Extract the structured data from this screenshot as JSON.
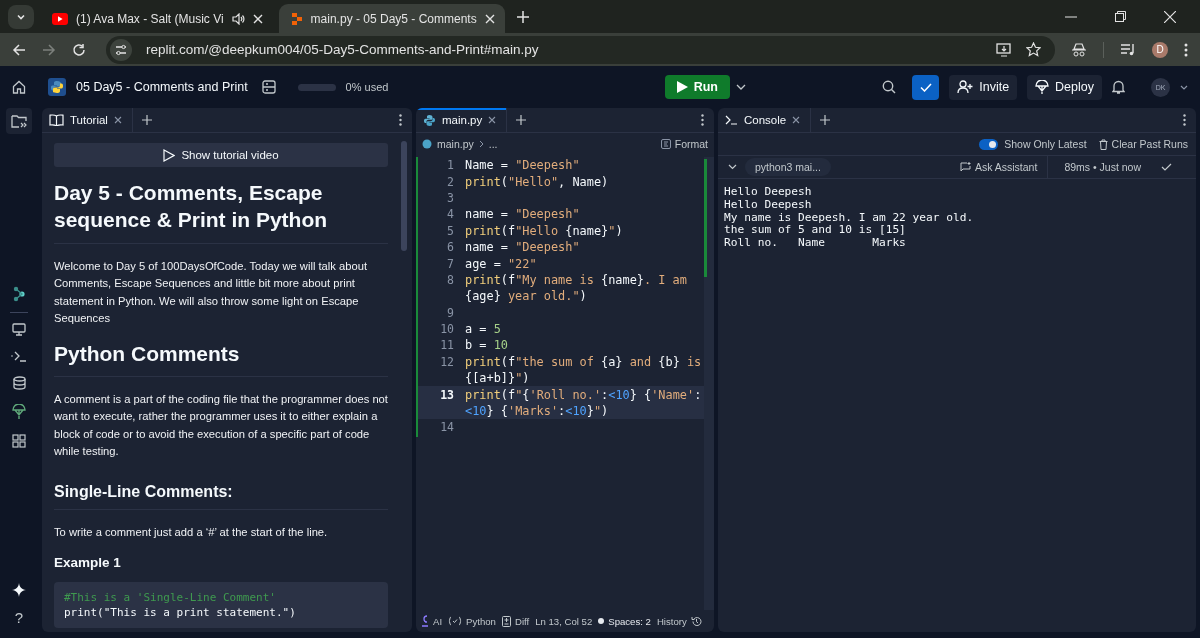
{
  "browser": {
    "tabs": [
      {
        "title": "(1) Ava Max - Salt (Music Vi",
        "selected": false,
        "audio": true
      },
      {
        "title": "main.py - 05 Day5 - Comments",
        "selected": true,
        "audio": false
      }
    ],
    "url": "replit.com/@deepkum004/05-Day5-Comments-and-Print#main.py",
    "profile": "D"
  },
  "header": {
    "project": "05 Day5 - Comments and Print",
    "usage": {
      "level": 0,
      "label": "0% used"
    },
    "run": "Run",
    "invite": "Invite",
    "deploy": "Deploy",
    "avatar": "DK"
  },
  "rail": {
    "help": "?"
  },
  "tutorial": {
    "tab": "Tutorial",
    "video_button": "Show tutorial video",
    "blocks": [
      {
        "kind": "h1",
        "text": "Day 5 - Comments, Escape sequence & Print in Python"
      },
      {
        "kind": "p",
        "text": "Welcome to Day 5 of 100DaysOfCode. Today we will talk about Comments, Escape Sequences and little bit more about print statement in Python. We will also throw some light on Escape Sequences"
      },
      {
        "kind": "h1",
        "text": "Python Comments"
      },
      {
        "kind": "p",
        "text": "A comment is a part of the coding file that the programmer does not want to execute, rather the programmer uses it to either explain a block of code or to avoid the execution of a specific part of code while testing."
      },
      {
        "kind": "h2",
        "text": "Single-Line Comments:"
      },
      {
        "kind": "p",
        "text": "To write a comment just add a ‘#’ at the start of the line."
      },
      {
        "kind": "h3",
        "text": "Example 1"
      },
      {
        "kind": "code",
        "lines": [
          {
            "kind": "comment",
            "text": "#This is a 'Single-Line Comment'"
          },
          {
            "kind": "plain",
            "text": "print(\"This is a print statement.\")"
          }
        ]
      }
    ]
  },
  "editor": {
    "tab": "main.py",
    "breadcrumb": "main.py",
    "breadcrumb_more": "...",
    "format": "Format",
    "lines": [
      {
        "number": "1",
        "current": false,
        "rows": [
          [
            {
              "kind": "plain",
              "text": "Name = "
            },
            {
              "kind": "str",
              "text": "\"Deepesh\""
            }
          ]
        ]
      },
      {
        "number": "2",
        "current": false,
        "rows": [
          [
            {
              "kind": "fn",
              "text": "print"
            },
            {
              "kind": "plain",
              "text": "("
            },
            {
              "kind": "str",
              "text": "\"Hello\""
            },
            {
              "kind": "plain",
              "text": ", Name)"
            }
          ]
        ]
      },
      {
        "number": "3",
        "current": false,
        "rows": [
          []
        ]
      },
      {
        "number": "4",
        "current": false,
        "rows": [
          [
            {
              "kind": "plain",
              "text": "name = "
            },
            {
              "kind": "str",
              "text": "\"Deepesh\""
            }
          ]
        ]
      },
      {
        "number": "5",
        "current": false,
        "rows": [
          [
            {
              "kind": "fn",
              "text": "print"
            },
            {
              "kind": "plain",
              "text": "(f"
            },
            {
              "kind": "str",
              "text": "\"Hello "
            },
            {
              "kind": "plain",
              "text": "{name}"
            },
            {
              "kind": "str",
              "text": "\""
            },
            {
              "kind": "plain",
              "text": ")"
            }
          ]
        ]
      },
      {
        "number": "6",
        "current": false,
        "rows": [
          [
            {
              "kind": "plain",
              "text": "name = "
            },
            {
              "kind": "str",
              "text": "\"Deepesh\""
            }
          ]
        ]
      },
      {
        "number": "7",
        "current": false,
        "rows": [
          [
            {
              "kind": "plain",
              "text": "age = "
            },
            {
              "kind": "str",
              "text": "\"22\""
            }
          ]
        ]
      },
      {
        "number": "8",
        "current": false,
        "rows": [
          [
            {
              "kind": "fn",
              "text": "print"
            },
            {
              "kind": "plain",
              "text": "(f"
            },
            {
              "kind": "str",
              "text": "\"My name is "
            },
            {
              "kind": "plain",
              "text": "{name}"
            },
            {
              "kind": "str",
              "text": ". I am"
            }
          ]
        ]
      },
      {
        "rows": [
          [
            {
              "kind": "plain",
              "text": "{age}"
            },
            {
              "kind": "str",
              "text": " year old.\""
            },
            {
              "kind": "plain",
              "text": ")"
            }
          ]
        ]
      },
      {
        "number": "9",
        "current": false,
        "rows": [
          []
        ]
      },
      {
        "number": "10",
        "current": false,
        "rows": [
          [
            {
              "kind": "plain",
              "text": "a = "
            },
            {
              "kind": "num",
              "text": "5"
            }
          ]
        ]
      },
      {
        "number": "11",
        "current": false,
        "rows": [
          [
            {
              "kind": "plain",
              "text": "b = "
            },
            {
              "kind": "num",
              "text": "10"
            }
          ]
        ]
      },
      {
        "number": "12",
        "current": false,
        "rows": [
          [
            {
              "kind": "fn",
              "text": "print"
            },
            {
              "kind": "plain",
              "text": "(f"
            },
            {
              "kind": "str",
              "text": "\"the sum of "
            },
            {
              "kind": "plain",
              "text": "{a}"
            },
            {
              "kind": "str",
              "text": " and "
            },
            {
              "kind": "plain",
              "text": "{b}"
            },
            {
              "kind": "str",
              "text": " is"
            }
          ]
        ]
      },
      {
        "rows": [
          [
            {
              "kind": "plain",
              "text": "{[a+b]}"
            },
            {
              "kind": "str",
              "text": "\""
            },
            {
              "kind": "plain",
              "text": ")"
            }
          ]
        ]
      },
      {
        "number": "13",
        "current": true,
        "rows": [
          [
            {
              "kind": "fn",
              "text": "print"
            },
            {
              "kind": "plain",
              "text": "(f"
            },
            {
              "kind": "str",
              "text": "\""
            },
            {
              "kind": "plain",
              "text": "{"
            },
            {
              "kind": "str",
              "text": "'Roll no.'"
            },
            {
              "kind": "plain",
              "text": ":"
            },
            {
              "kind": "spec",
              "text": "<10"
            },
            {
              "kind": "plain",
              "text": "} {"
            },
            {
              "kind": "str",
              "text": "'Name'"
            },
            {
              "kind": "plain",
              "text": ":"
            }
          ]
        ]
      },
      {
        "rows": [
          [
            {
              "kind": "spec",
              "text": "<10"
            },
            {
              "kind": "plain",
              "text": "} {"
            },
            {
              "kind": "str",
              "text": "'Marks'"
            },
            {
              "kind": "plain",
              "text": ":"
            },
            {
              "kind": "spec",
              "text": "<10"
            },
            {
              "kind": "plain",
              "text": "}"
            },
            {
              "kind": "str",
              "text": "\""
            },
            {
              "kind": "plain",
              "text": ")"
            }
          ]
        ]
      },
      {
        "number": "14",
        "current": false,
        "rows": [
          []
        ]
      }
    ],
    "status": {
      "ai": "AI",
      "language": "Python",
      "diff": "Diff",
      "position": "Ln 13, Col 52",
      "spaces": "Spaces: 2",
      "history": "History"
    }
  },
  "console": {
    "tab": "Console",
    "show_latest": {
      "label": "Show Only Latest",
      "on": true
    },
    "clear": "Clear Past Runs",
    "run": {
      "name": "python3 mai...",
      "ask": "Ask Assistant",
      "timing": "89ms • Just now"
    },
    "output": [
      "Hello Deepesh",
      "Hello Deepesh",
      "My name is Deepesh. I am 22 year old.",
      "the sum of 5 and 10 is [15]",
      "Roll no.   Name       Marks"
    ]
  }
}
